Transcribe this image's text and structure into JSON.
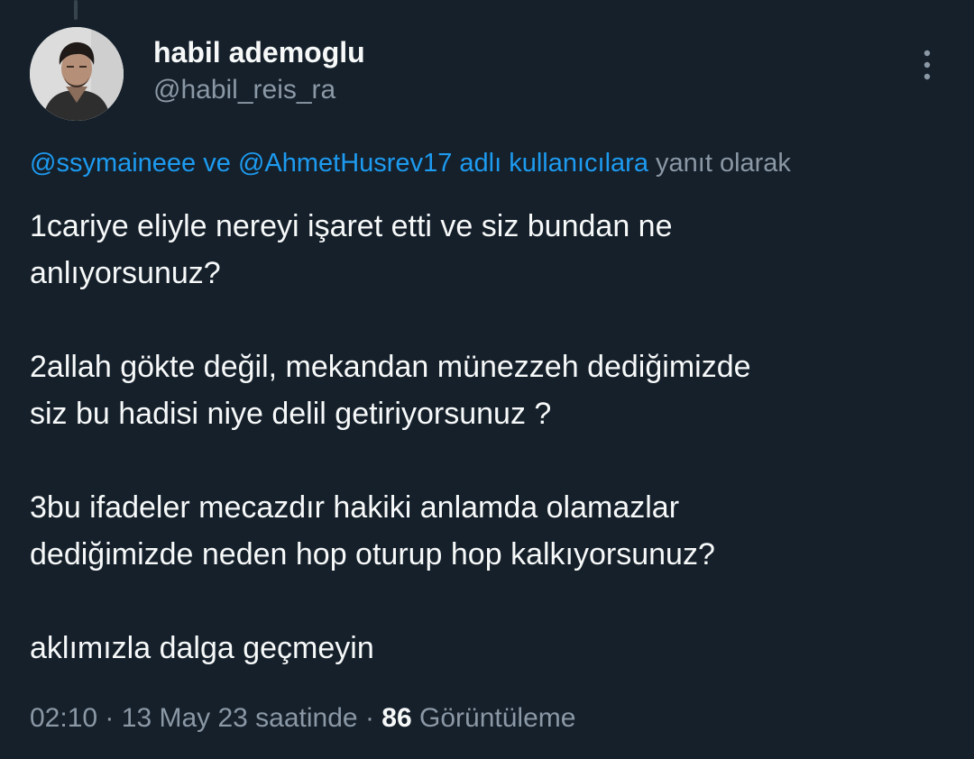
{
  "author": {
    "display_name": "habil ademoglu",
    "handle": "@habil_reis_ra"
  },
  "reply_context": {
    "user1": "@ssymaineee",
    "connector": "ve",
    "user2": "@AhmetHusrev17",
    "suffix_link": "adlı kullanıcılara",
    "suffix_plain": "yanıt olarak"
  },
  "tweet": {
    "paragraphs": [
      "1cariye eliyle nereyi işaret etti ve siz bundan ne\nanlıyorsunuz?",
      "2allah gökte değil, mekandan münezzeh dediğimizde\nsiz bu hadisi niye delil getiriyorsunuz ?",
      "3bu ifadeler mecazdır hakiki anlamda olamazlar\ndediğimizde neden hop oturup hop kalkıyorsunuz?",
      "aklımızla dalga geçmeyin"
    ]
  },
  "meta": {
    "time": "02:10",
    "separator": "·",
    "date": "13 May 23 saatinde",
    "views_count": "86",
    "views_label": "Görüntüleme"
  },
  "icons": {
    "more": "more-vertical-icon",
    "avatar": "avatar-photo"
  },
  "colors": {
    "background": "#15202b",
    "text_primary": "#f7f9f9",
    "text_secondary": "#8b98a5",
    "link": "#1d9bf0"
  }
}
